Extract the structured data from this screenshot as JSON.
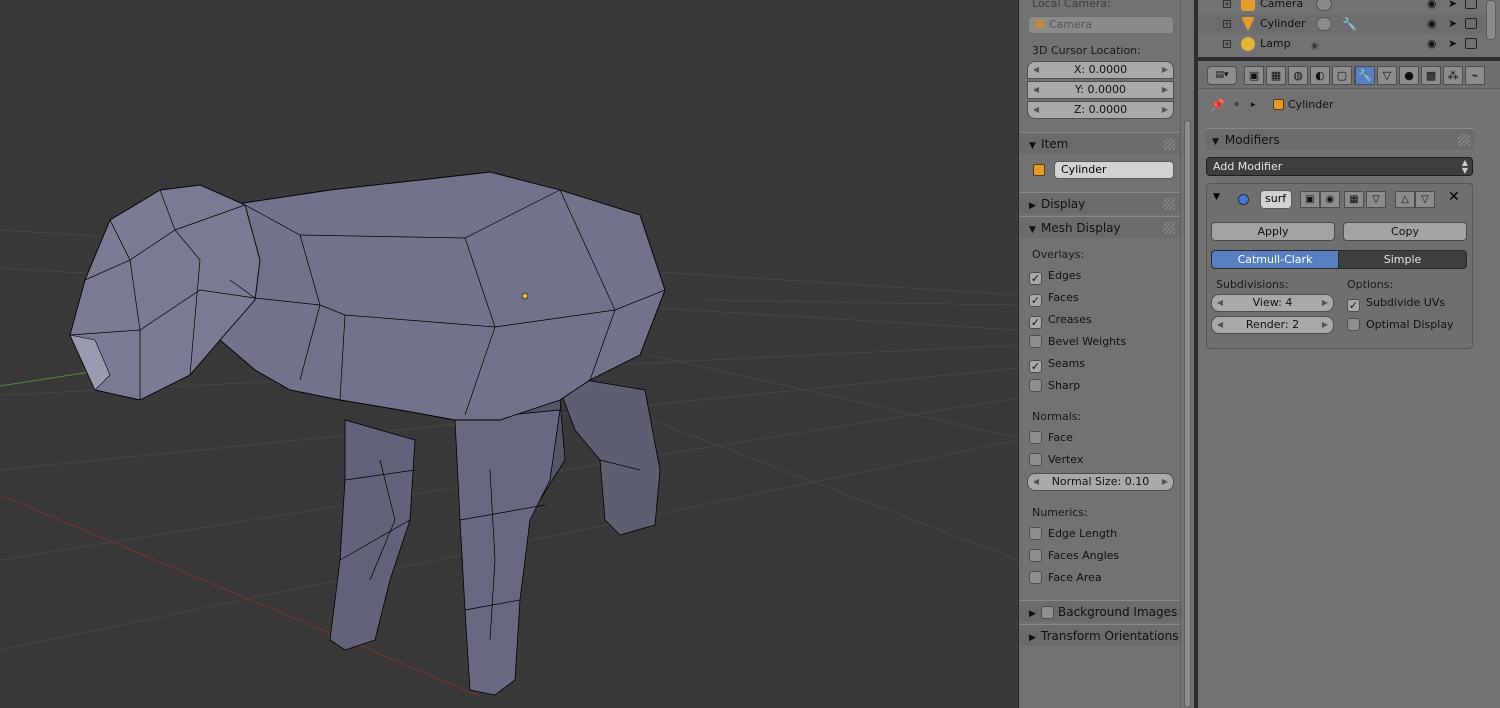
{
  "npanel": {
    "view_section": {
      "local_camera_label": "Local Camera:",
      "local_camera_value": "Camera",
      "cursor_label": "3D Cursor Location:",
      "cursor_x": "X: 0.0000",
      "cursor_y": "Y: 0.0000",
      "cursor_z": "Z: 0.0000"
    },
    "item_section": {
      "title": "Item",
      "name_value": "Cylinder"
    },
    "display_section": {
      "title": "Display"
    },
    "mesh_display": {
      "title": "Mesh Display",
      "overlays_label": "Overlays:",
      "overlays": [
        {
          "label": "Edges",
          "checked": true
        },
        {
          "label": "Faces",
          "checked": true
        },
        {
          "label": "Creases",
          "checked": true
        },
        {
          "label": "Bevel Weights",
          "checked": false
        },
        {
          "label": "Seams",
          "checked": true
        },
        {
          "label": "Sharp",
          "checked": false
        }
      ],
      "normals_label": "Normals:",
      "normals": [
        {
          "label": "Face",
          "checked": false
        },
        {
          "label": "Vertex",
          "checked": false
        }
      ],
      "normal_size": "Normal Size: 0.10",
      "numerics_label": "Numerics:",
      "numerics": [
        {
          "label": "Edge Length",
          "checked": false
        },
        {
          "label": "Faces Angles",
          "checked": false
        },
        {
          "label": "Face Area",
          "checked": false
        }
      ]
    },
    "background_images": {
      "title": "Background Images"
    },
    "transform_orientations": {
      "title": "Transform Orientations"
    }
  },
  "outliner": {
    "rows": [
      {
        "name": "Camera",
        "icon_color": "#e59a2e"
      },
      {
        "name": "Cylinder",
        "icon_color": "#e59a2e"
      },
      {
        "name": "Lamp",
        "icon_color": "#e5b437"
      }
    ]
  },
  "properties": {
    "toolbar_editor_icon": "properties-editor-icon",
    "breadcrumb_object": "Cylinder",
    "modifiers_title": "Modifiers",
    "add_modifier_label": "Add Modifier",
    "modifier": {
      "name": "surf",
      "apply_label": "Apply",
      "copy_label": "Copy",
      "mode_catmull": "Catmull-Clark",
      "mode_simple": "Simple",
      "subdivisions_label": "Subdivisions:",
      "view_value": "View: 4",
      "render_value": "Render: 2",
      "options_label": "Options:",
      "subdivide_uvs_label": "Subdivide UVs",
      "subdivide_uvs_checked": true,
      "optimal_display_label": "Optimal Display",
      "optimal_display_checked": false
    }
  },
  "colors": {
    "viewport_bg": "#393939",
    "panel_bg": "#727272",
    "accent_blue": "#5680c2",
    "mesh_fill": "#6b6b86"
  }
}
